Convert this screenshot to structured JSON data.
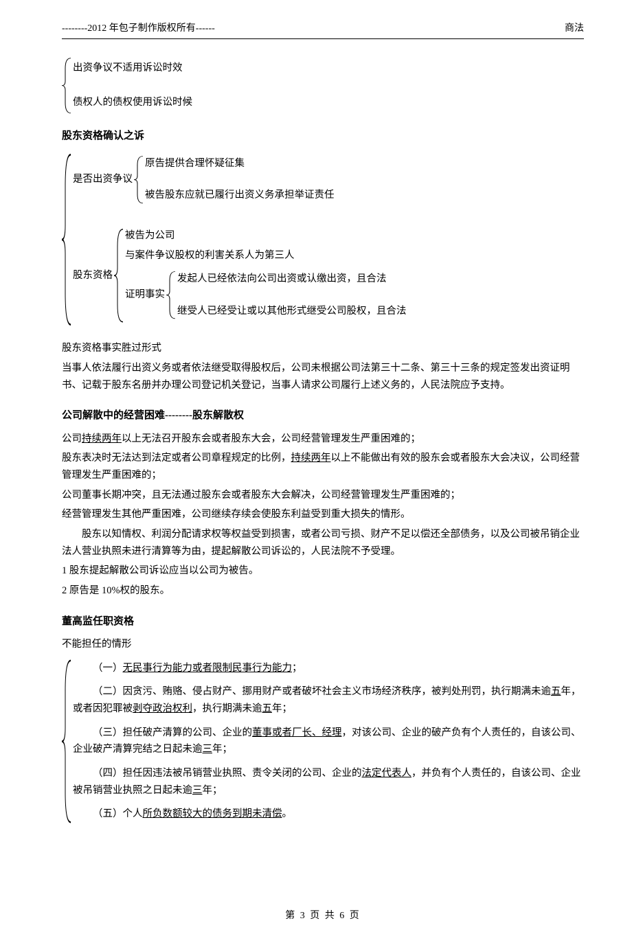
{
  "header": {
    "left": "--------2012 年包子制作版权所有------",
    "right": "商法"
  },
  "sec0": {
    "b1": "出资争议不适用诉讼时效",
    "b2": "债权人的债权使用诉讼时候"
  },
  "sec1": {
    "title": "股东资格确认之诉",
    "lbl_dispute": "是否出资争议",
    "d1": "原告提供合理怀疑征集",
    "d2": "被告股东应就已履行出资义务承担举证责任",
    "lbl_qual": "股东资格",
    "q1": "被告为公司",
    "q2": "与案件争议股权的利害关系人为第三人",
    "lbl_proof": "证明事实",
    "p1": "发起人已经依法向公司出资或认缴出资，且合法",
    "p2": "继受人已经受让或以其他形式继受公司股权，且合法",
    "after1": "股东资格事实胜过形式",
    "after2": "当事人依法履行出资义务或者依法继受取得股权后，公司未根据公司法第三十二条、第三十三条的规定签发出资证明书、记载于股东名册并办理公司登记机关登记，当事人请求公司履行上述义务的，人民法院应予支持。"
  },
  "sec2": {
    "title": "公司解散中的经营困难--------股东解散权",
    "l1a": "公司",
    "l1b": "持续两年",
    "l1c": "以上无法召开股东会或者股东大会，公司经营管理发生严重困难的；",
    "l2a": "股东表决时无法达到法定或者公司章程规定的比例，",
    "l2b": "持续两年",
    "l2c": "以上不能做出有效的股东会或者股东大会决议，公司经营管理发生严重困难的；",
    "l3": "公司董事长期冲突，且无法通过股东会或者股东大会解决，公司经营管理发生严重困难的；",
    "l4": "经营管理发生其他严重困难，公司继续存续会使股东利益受到重大损失的情形。",
    "l5": "股东以知情权、利润分配请求权等权益受到损害，或者公司亏损、财产不足以偿还全部债务，以及公司被吊销企业法人营业执照未进行清算等为由，提起解散公司诉讼的，人民法院不予受理。",
    "l6": "1 股东提起解散公司诉讼应当以公司为被告。",
    "l7": "2 原告是 10%权的股东。"
  },
  "sec3": {
    "title": "董高监任职资格",
    "intro": "不能担任的情形",
    "i1a": "（一）",
    "i1b": "无民事行为能力或者限制民事行为能力",
    "i1c": "；",
    "i2a": "（二）因贪污、贿赂、侵占财产、挪用财产或者破坏社会主义市场经济秩序，被判处刑罚，执行期满未逾",
    "i2b": "五",
    "i2c": "年，或者因犯罪被",
    "i2d": "剥夺政治权利",
    "i2e": "，执行期满未逾",
    "i2f": "五",
    "i2g": "年；",
    "i3a": "（三）担任破产清算的公司、企业的",
    "i3b": "董事或者厂长、经理",
    "i3c": "，对该公司、企业的破产负有个人责任的，自该公司、企业破产清算完结之日起未逾",
    "i3d": "三",
    "i3e": "年；",
    "i4a": "（四）担任因违法被吊销营业执照、责令关闭的公司、企业的",
    "i4b": "法定代表人",
    "i4c": "，并负有个人责任的，自该公司、企业被吊销营业执照之日起未逾",
    "i4d": "三",
    "i4e": "年；",
    "i5a": "（五）个人",
    "i5b": "所负数额较大的债务到期未清偿",
    "i5c": "。"
  },
  "footer": {
    "t1": "第 ",
    "pg": "3",
    "t2": " 页 共 ",
    "total": "6",
    "t3": " 页"
  }
}
